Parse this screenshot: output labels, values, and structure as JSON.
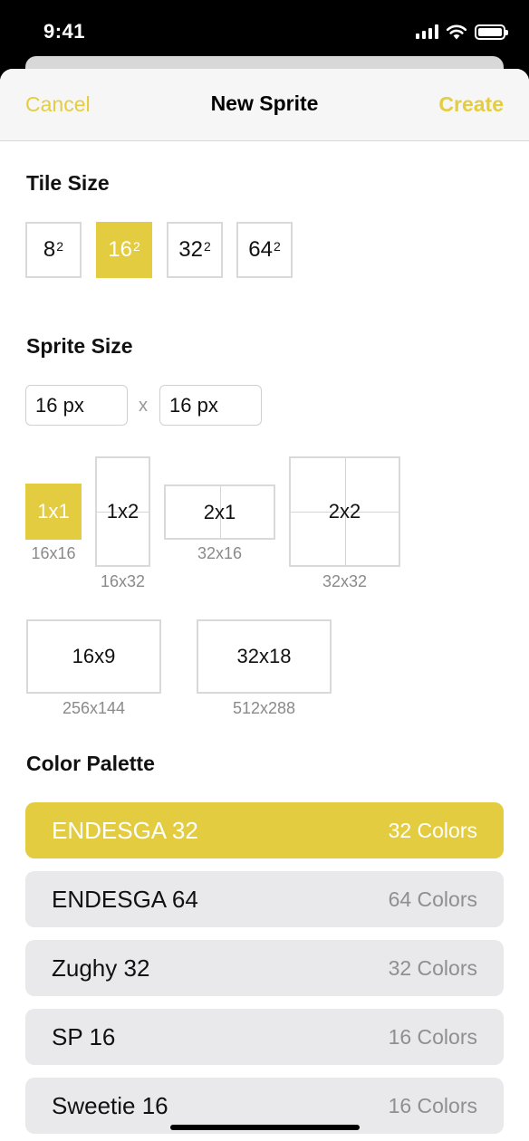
{
  "status_bar": {
    "time": "9:41"
  },
  "nav": {
    "cancel": "Cancel",
    "title": "New Sprite",
    "create": "Create"
  },
  "accent_color": "#E3CC40",
  "tile_size": {
    "title": "Tile Size",
    "options": [
      {
        "base": "8",
        "exp": "2",
        "selected": false
      },
      {
        "base": "16",
        "exp": "2",
        "selected": true
      },
      {
        "base": "32",
        "exp": "2",
        "selected": false
      },
      {
        "base": "64",
        "exp": "2",
        "selected": false
      }
    ]
  },
  "sprite_size": {
    "title": "Sprite Size",
    "width_value": "16 px",
    "separator": "x",
    "height_value": "16 px",
    "grid_options": [
      {
        "label": "1x1",
        "size": "16x16",
        "selected": true
      },
      {
        "label": "1x2",
        "size": "16x32",
        "selected": false
      },
      {
        "label": "2x1",
        "size": "32x16",
        "selected": false
      },
      {
        "label": "2x2",
        "size": "32x32",
        "selected": false
      },
      {
        "label": "16x9",
        "size": "256x144",
        "selected": false
      },
      {
        "label": "32x18",
        "size": "512x288",
        "selected": false
      }
    ]
  },
  "color_palette": {
    "title": "Color Palette",
    "items": [
      {
        "name": "ENDESGA 32",
        "count": "32 Colors",
        "selected": true
      },
      {
        "name": "ENDESGA 64",
        "count": "64 Colors",
        "selected": false
      },
      {
        "name": "Zughy 32",
        "count": "32 Colors",
        "selected": false
      },
      {
        "name": "SP 16",
        "count": "16 Colors",
        "selected": false
      },
      {
        "name": "Sweetie 16",
        "count": "16 Colors",
        "selected": false
      }
    ]
  }
}
